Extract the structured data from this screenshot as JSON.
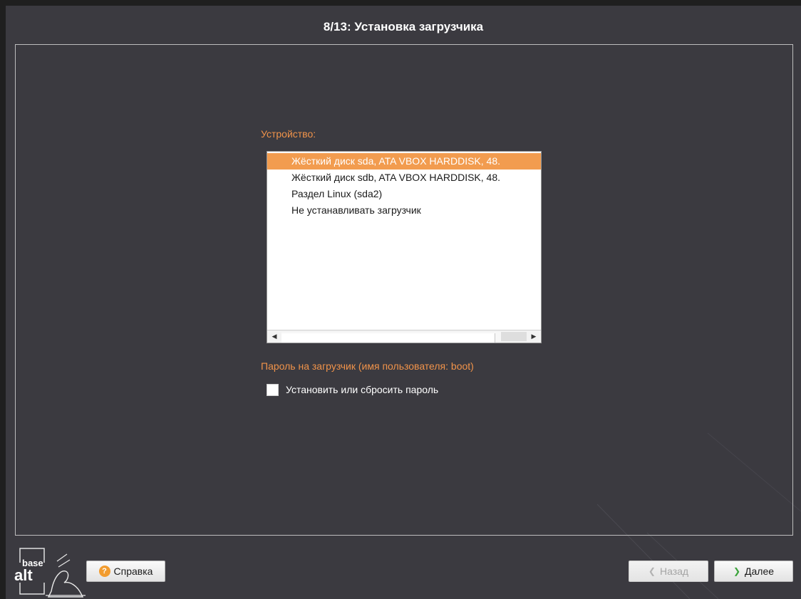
{
  "window": {
    "title": "8/13: Установка загрузчика"
  },
  "bootloader": {
    "device_label": "Устройство:",
    "devices": [
      "Жёсткий диск sda, ATA VBOX HARDDISK, 48.",
      "Жёсткий диск sdb, ATA VBOX HARDDISK, 48.",
      "Раздел Linux (sda2)",
      "Не устанавливать загрузчик"
    ],
    "selected_device_index": 0,
    "password_label": "Пароль на загрузчик (имя пользователя: boot)",
    "password_checkbox_label": "Установить или сбросить пароль",
    "password_checkbox_checked": false
  },
  "logo": {
    "top_text": "base",
    "bottom_text": "alt"
  },
  "footer": {
    "help_label": "Справка",
    "back_label": "Назад",
    "next_label": "Далее",
    "back_enabled": false
  },
  "colors": {
    "background": "#3b3a40",
    "accent": "#f0934a",
    "selection": "#f29c4f"
  },
  "icons": {
    "help": "help-icon",
    "back": "chevron-left-icon",
    "next": "chevron-right-icon",
    "scroll_left": "scroll-left-arrow-icon",
    "scroll_right": "scroll-right-arrow-icon",
    "logo": "basealt-logo"
  }
}
